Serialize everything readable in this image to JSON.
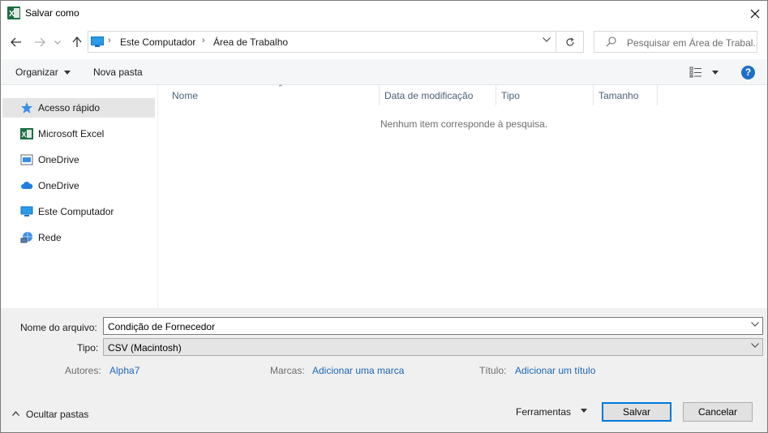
{
  "window": {
    "title": "Salvar como"
  },
  "nav": {
    "breadcrumb": [
      "Este Computador",
      "Área de Trabalho"
    ],
    "search_placeholder": "Pesquisar em Área de Trabal..."
  },
  "toolbar": {
    "organize": "Organizar",
    "new_folder": "Nova pasta"
  },
  "sidebar": {
    "items": [
      {
        "label": "Acesso rápido",
        "icon": "star-icon",
        "selected": true
      },
      {
        "label": "Microsoft Excel",
        "icon": "excel-icon",
        "selected": false
      },
      {
        "label": "OneDrive",
        "icon": "onedrive-folder-icon",
        "selected": false
      },
      {
        "label": "OneDrive",
        "icon": "onedrive-cloud-icon",
        "selected": false
      },
      {
        "label": "Este Computador",
        "icon": "computer-icon",
        "selected": false
      },
      {
        "label": "Rede",
        "icon": "network-icon",
        "selected": false
      }
    ]
  },
  "filelist": {
    "columns": [
      "Nome",
      "Data de modificação",
      "Tipo",
      "Tamanho"
    ],
    "empty_message": "Nenhum item corresponde à pesquisa."
  },
  "form": {
    "filename_label": "Nome do arquivo:",
    "filename_value": "Condição de Fornecedor",
    "type_label": "Tipo:",
    "type_value": "CSV (Macintosh)",
    "authors_label": "Autores:",
    "authors_value": "Alpha7",
    "tags_label": "Marcas:",
    "tags_value": "Adicionar uma marca",
    "title_label": "Título:",
    "title_value": "Adicionar um título"
  },
  "footer": {
    "hide_folders": "Ocultar pastas",
    "tools": "Ferramentas",
    "save": "Salvar",
    "cancel": "Cancelar"
  },
  "colors": {
    "accent": "#0078d7",
    "link": "#1b67b8",
    "help": "#1f6fc5"
  }
}
